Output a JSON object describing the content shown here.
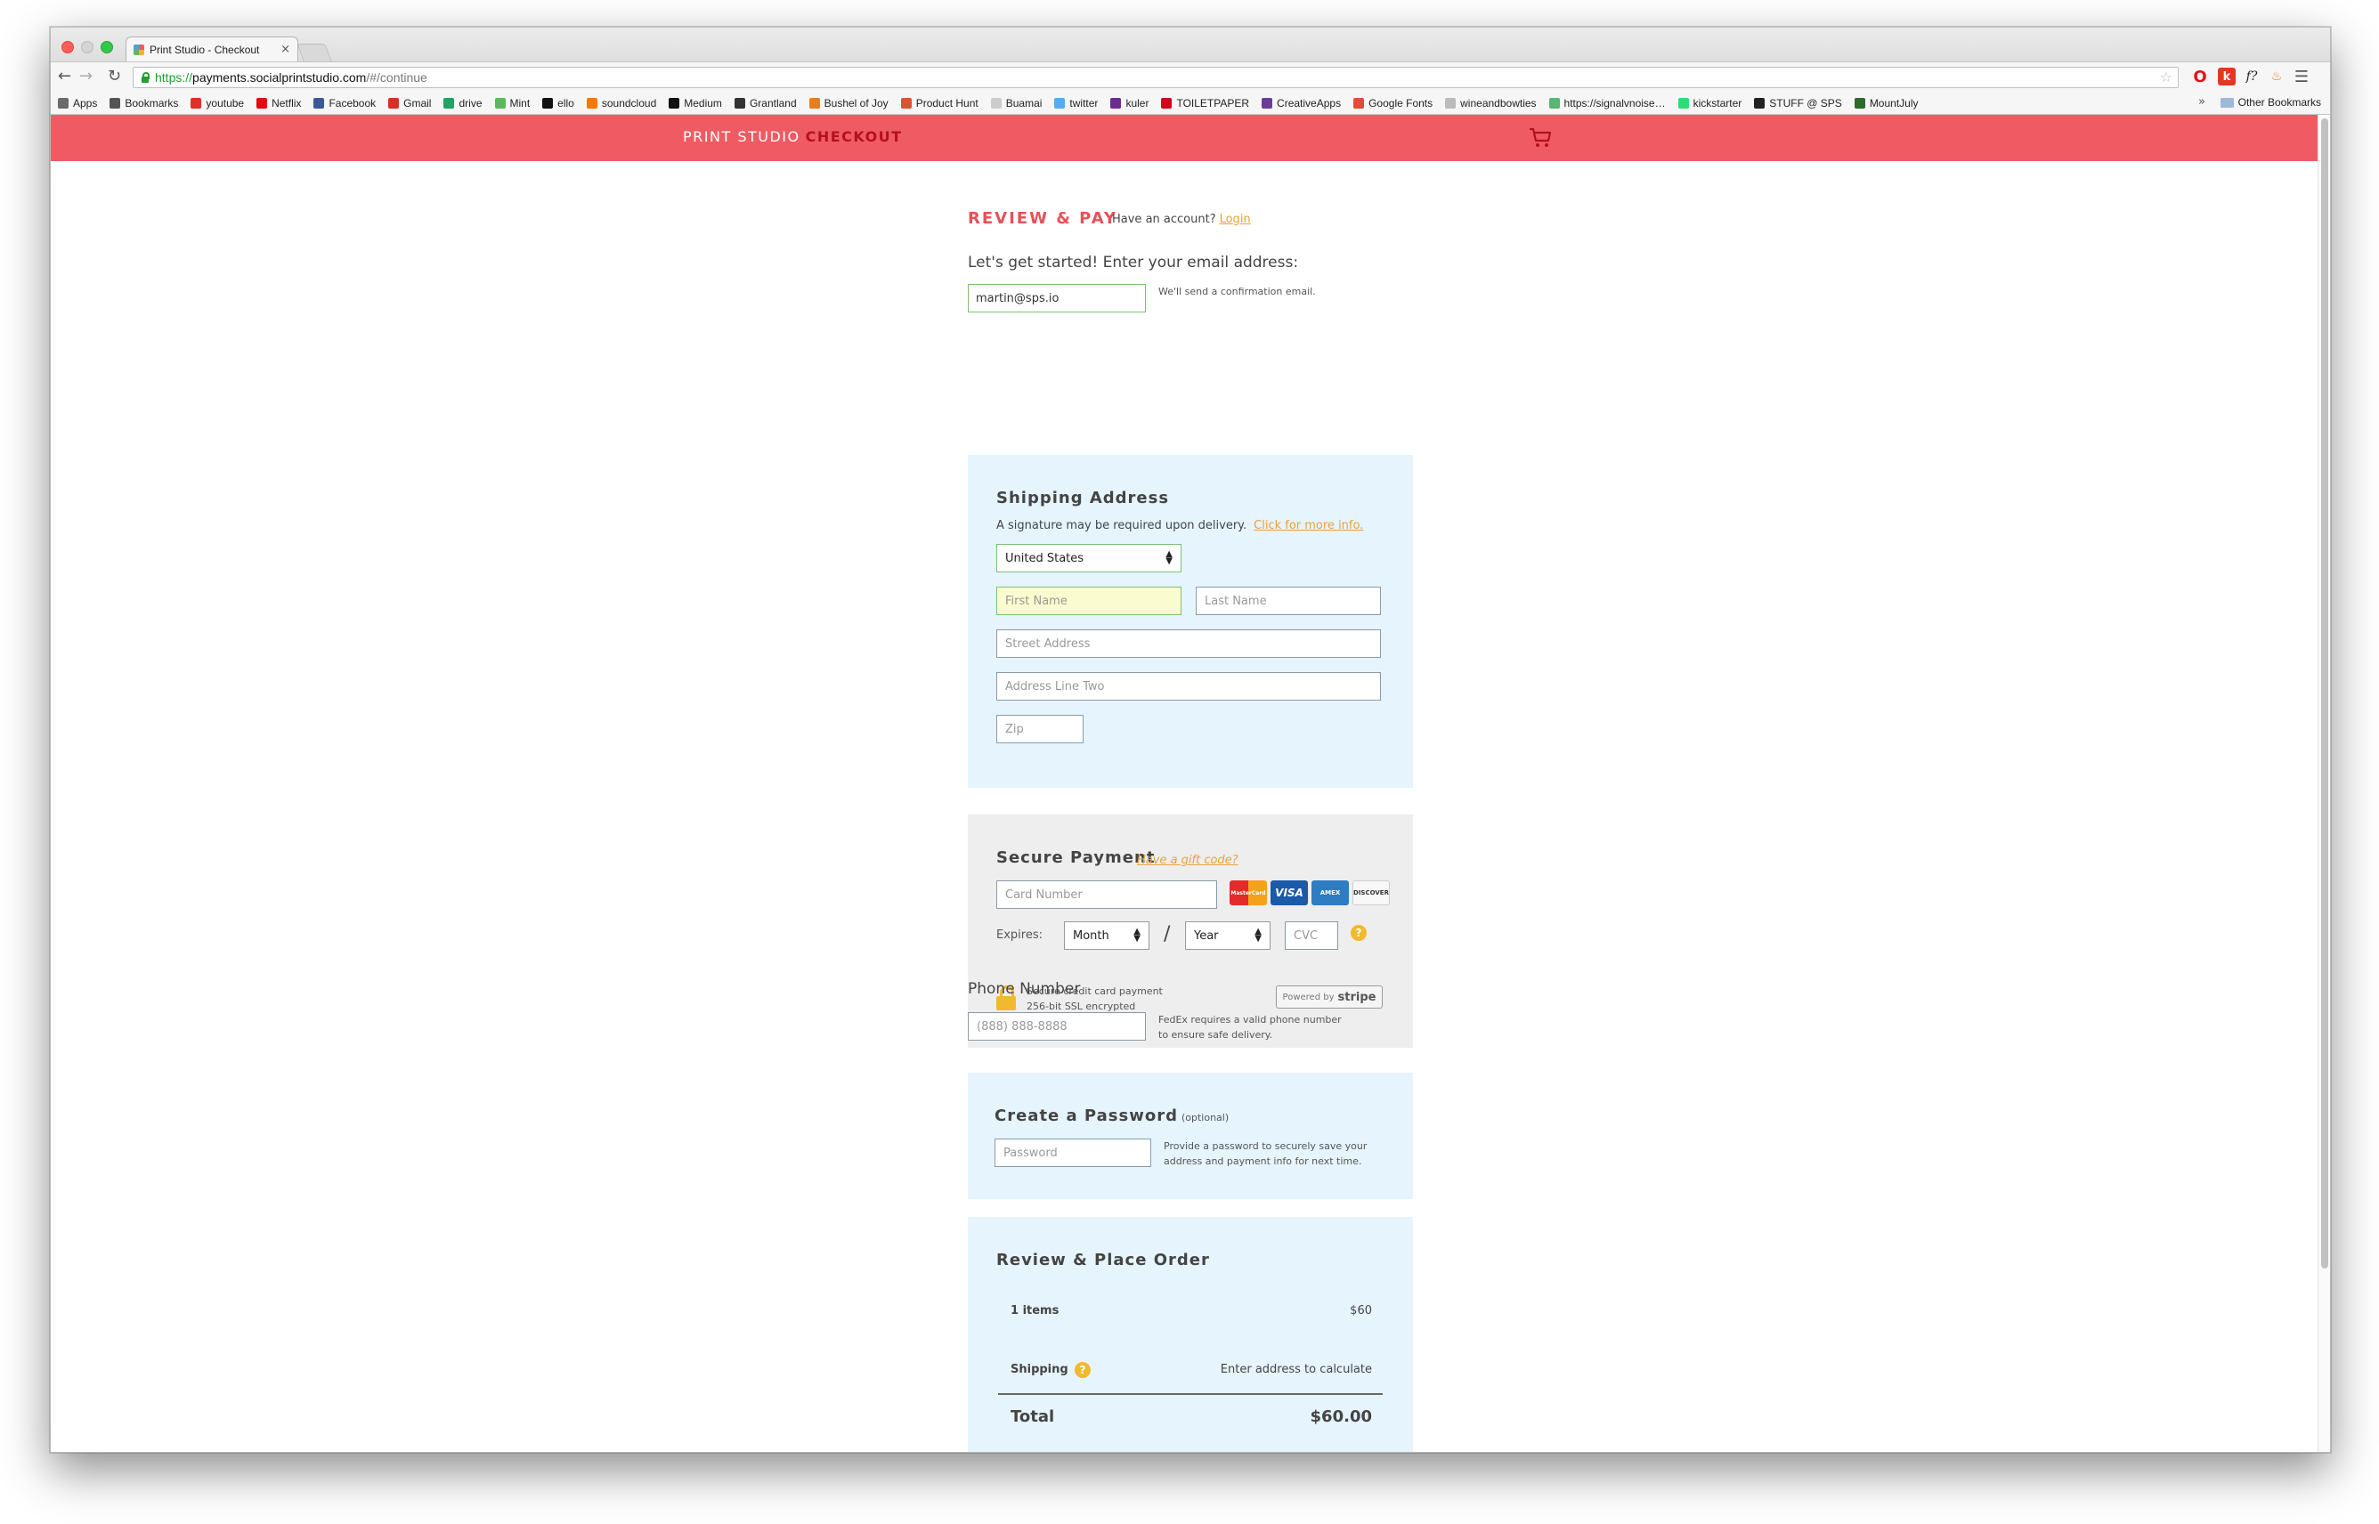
{
  "browser": {
    "tab_title": "Print Studio - Checkout",
    "tab_close": "×",
    "url_scheme": "https://",
    "url_host": "payments.socialprintstudio.com",
    "url_path": "/#/continue",
    "bookmarks": [
      {
        "label": "Apps",
        "color": "#6b6b6b"
      },
      {
        "label": "Bookmarks",
        "color": "#555555"
      },
      {
        "label": "youtube",
        "color": "#e52d27"
      },
      {
        "label": "Netflix",
        "color": "#e50914"
      },
      {
        "label": "Facebook",
        "color": "#3b5998"
      },
      {
        "label": "Gmail",
        "color": "#d93025"
      },
      {
        "label": "drive",
        "color": "#1fa463"
      },
      {
        "label": "Mint",
        "color": "#5cb85c"
      },
      {
        "label": "ello",
        "color": "#111111"
      },
      {
        "label": "soundcloud",
        "color": "#ff7700"
      },
      {
        "label": "Medium",
        "color": "#111111"
      },
      {
        "label": "Grantland",
        "color": "#333333"
      },
      {
        "label": "Bushel of Joy",
        "color": "#e67e22"
      },
      {
        "label": "Product Hunt",
        "color": "#da552f"
      },
      {
        "label": "Buamai",
        "color": "#cccccc"
      },
      {
        "label": "twitter",
        "color": "#55acee"
      },
      {
        "label": "kuler",
        "color": "#6b2c91"
      },
      {
        "label": "TOILETPAPER",
        "color": "#d0021b"
      },
      {
        "label": "CreativeApps",
        "color": "#6c3c9c"
      },
      {
        "label": "Google Fonts",
        "color": "#e64a3b"
      },
      {
        "label": "wineandbowties",
        "color": "#bbbbbb"
      },
      {
        "label": "https://signalvnoise…",
        "color": "#56b870"
      },
      {
        "label": "kickstarter",
        "color": "#2bde73"
      },
      {
        "label": "STUFF @ SPS",
        "color": "#222222"
      },
      {
        "label": "MountJuly",
        "color": "#2d6b2d"
      }
    ],
    "bookmarks_more": "»",
    "other_bookmarks": "Other Bookmarks"
  },
  "header": {
    "brand_primary": "PRINT STUDIO",
    "brand_secondary": "CHECKOUT",
    "cart_icon": "cart-icon"
  },
  "review": {
    "title": "REVIEW & PAY",
    "have_account": "Have an account?",
    "login_link": "Login"
  },
  "email": {
    "lead": "Let's get started! Enter your email address:",
    "value": "martin@sps.io",
    "note": "We'll send a confirmation email."
  },
  "shipping": {
    "title": "Shipping Address",
    "note": "A signature may be required upon delivery.",
    "more_info_link": "Click for more info.",
    "country": "United States",
    "first_name_placeholder": "First Name",
    "last_name_placeholder": "Last Name",
    "street_placeholder": "Street Address",
    "line_two_placeholder": "Address Line Two",
    "zip_placeholder": "Zip"
  },
  "payment": {
    "title": "Secure Payment",
    "gift_link": "Have a gift code?",
    "card_placeholder": "Card Number",
    "cards": [
      "MasterCard",
      "VISA",
      "AMEX",
      "DISCOVER"
    ],
    "expires_label": "Expires:",
    "month": "Month",
    "slash": "/",
    "year": "Year",
    "cvc_placeholder": "CVC",
    "help": "?",
    "secure_line1": "Secure credit card payment",
    "secure_line2": "256-bit SSL encrypted",
    "powered_by": "Powered by",
    "stripe": "stripe"
  },
  "phone": {
    "label": "Phone Number",
    "placeholder": "(888) 888-8888",
    "note_line1": "FedEx requires a valid phone number",
    "note_line2": "to ensure safe delivery."
  },
  "password": {
    "title": "Create a Password",
    "optional": "(optional)",
    "placeholder": "Password",
    "note_line1": "Provide a password to securely save your",
    "note_line2": "address and payment info for next time."
  },
  "order": {
    "title": "Review & Place Order",
    "items_label": "1 items",
    "items_value": "$60",
    "shipping_label": "Shipping",
    "shipping_help": "?",
    "shipping_value": "Enter address to calculate",
    "total_label": "Total",
    "total_value": "$60.00"
  },
  "colors": {
    "header": "#f05b63",
    "accent_red": "#e9505a",
    "link_orange": "#e7a33b",
    "panel_blue": "#e6f4fd",
    "panel_gray": "#eeeeee",
    "help_yellow": "#f1b92e"
  }
}
